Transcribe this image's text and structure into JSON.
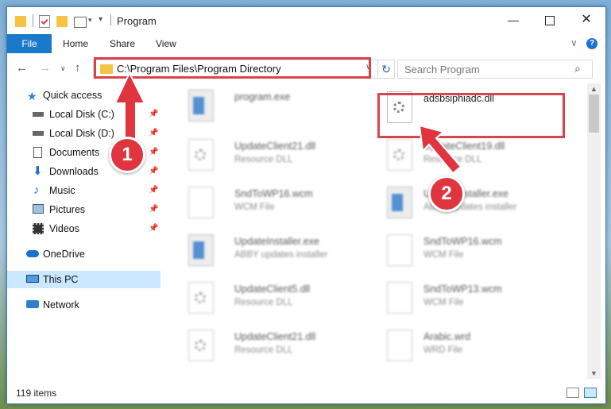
{
  "window": {
    "title": "Program",
    "controls": [
      "minimize-icon",
      "maximize-icon",
      "close-icon"
    ]
  },
  "ribbon": {
    "tabs": [
      "File",
      "Home",
      "Share",
      "View"
    ],
    "help": "?"
  },
  "address_bar": {
    "path": "C:\\Program Files\\Program Directory"
  },
  "search": {
    "placeholder": "Search Program"
  },
  "nav_pane": {
    "items": [
      {
        "label": "Quick access",
        "icon": "star-icon"
      },
      {
        "label": "Local Disk (C:)",
        "icon": "drive-icon",
        "pinned": true
      },
      {
        "label": "Local Disk (D:)",
        "icon": "drive-icon",
        "pinned": true
      },
      {
        "label": "Documents",
        "icon": "documents-icon",
        "pinned": true
      },
      {
        "label": "Downloads",
        "icon": "download-icon",
        "pinned": true
      },
      {
        "label": "Music",
        "icon": "music-icon",
        "pinned": true
      },
      {
        "label": "Pictures",
        "icon": "pictures-icon",
        "pinned": true
      },
      {
        "label": "Videos",
        "icon": "videos-icon",
        "pinned": true
      },
      {
        "label": "OneDrive",
        "icon": "cloud-icon"
      },
      {
        "label": "This PC",
        "icon": "computer-icon",
        "selected": true
      },
      {
        "label": "Network",
        "icon": "network-icon"
      }
    ]
  },
  "files": [
    {
      "name": "program.exe",
      "type": "",
      "icon": "exe"
    },
    {
      "name": "adsbsiphiadc.dll",
      "type": "",
      "icon": "dll",
      "highlighted": true
    },
    {
      "name": "UpdateClient21.dll",
      "type": "Resource DLL",
      "icon": "dll"
    },
    {
      "name": "UpdateClient19.dll",
      "type": "Resource DLL",
      "icon": "dll"
    },
    {
      "name": "SndToWP16.wcm",
      "type": "WCM File",
      "icon": "doc"
    },
    {
      "name": "UpdateInstaller.exe",
      "type": "ABBY updates installer",
      "icon": "exe"
    },
    {
      "name": "UpdateInstaller.exe",
      "type": "ABBY updates installer",
      "icon": "exe"
    },
    {
      "name": "SndToWP16.wcm",
      "type": "WCM File",
      "icon": "doc"
    },
    {
      "name": "UpdateClient5.dll",
      "type": "Resource DLL",
      "icon": "dll"
    },
    {
      "name": "SndToWP13.wcm",
      "type": "WCM File",
      "icon": "doc"
    },
    {
      "name": "UpdateClient21.dll",
      "type": "Resource DLL",
      "icon": "dll"
    },
    {
      "name": "Arabic.wrd",
      "type": "WRD File",
      "icon": "doc"
    }
  ],
  "status": {
    "items": "119 items"
  },
  "annotations": [
    {
      "number": "1"
    },
    {
      "number": "2"
    }
  ],
  "colors": {
    "accent": "#1979ca",
    "highlight": "#d9434b",
    "selection": "#cce8ff"
  }
}
